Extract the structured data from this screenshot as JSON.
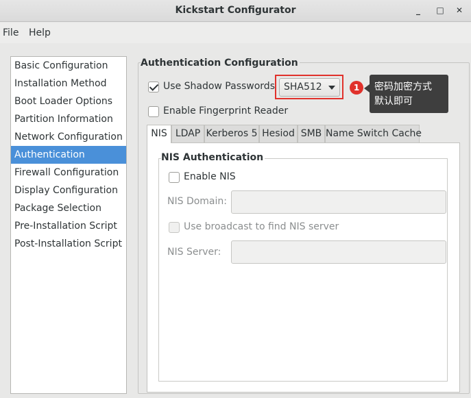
{
  "window": {
    "title": "Kickstart Configurator",
    "controls": {
      "minimize": "_",
      "maximize": "□",
      "close": "✕"
    }
  },
  "menu": {
    "file": "File",
    "help": "Help"
  },
  "sidebar": {
    "items": [
      {
        "label": "Basic Configuration"
      },
      {
        "label": "Installation Method"
      },
      {
        "label": "Boot Loader Options"
      },
      {
        "label": "Partition Information"
      },
      {
        "label": "Network Configuration"
      },
      {
        "label": "Authentication",
        "selected": true
      },
      {
        "label": "Firewall Configuration"
      },
      {
        "label": "Display Configuration"
      },
      {
        "label": "Package Selection"
      },
      {
        "label": "Pre-Installation Script"
      },
      {
        "label": "Post-Installation Script"
      }
    ]
  },
  "auth": {
    "section_title": "Authentication Configuration",
    "shadow_passwords": {
      "label": "Use Shadow Passwords",
      "checked": true
    },
    "encryption": {
      "value": "SHA512"
    },
    "fingerprint": {
      "label": "Enable Fingerprint Reader",
      "checked": false
    }
  },
  "annotation": {
    "badge": "1",
    "line1": "密码加密方式",
    "line2": "默认即可",
    "highlight_color": "#e0312b"
  },
  "tabs": [
    {
      "label": "NIS",
      "active": true
    },
    {
      "label": "LDAP"
    },
    {
      "label": "Kerberos 5"
    },
    {
      "label": "Hesiod"
    },
    {
      "label": "SMB"
    },
    {
      "label": "Name Switch Cache"
    }
  ],
  "nis": {
    "section_title": "NIS Authentication",
    "enable": {
      "label": "Enable NIS",
      "checked": false
    },
    "domain": {
      "label": "NIS Domain:",
      "value": ""
    },
    "broadcast": {
      "label": "Use broadcast to find NIS server",
      "checked": false
    },
    "server": {
      "label": "NIS Server:",
      "value": ""
    }
  },
  "colors": {
    "selection": "#4a90d9",
    "callout_bg": "#3e3e3e"
  }
}
